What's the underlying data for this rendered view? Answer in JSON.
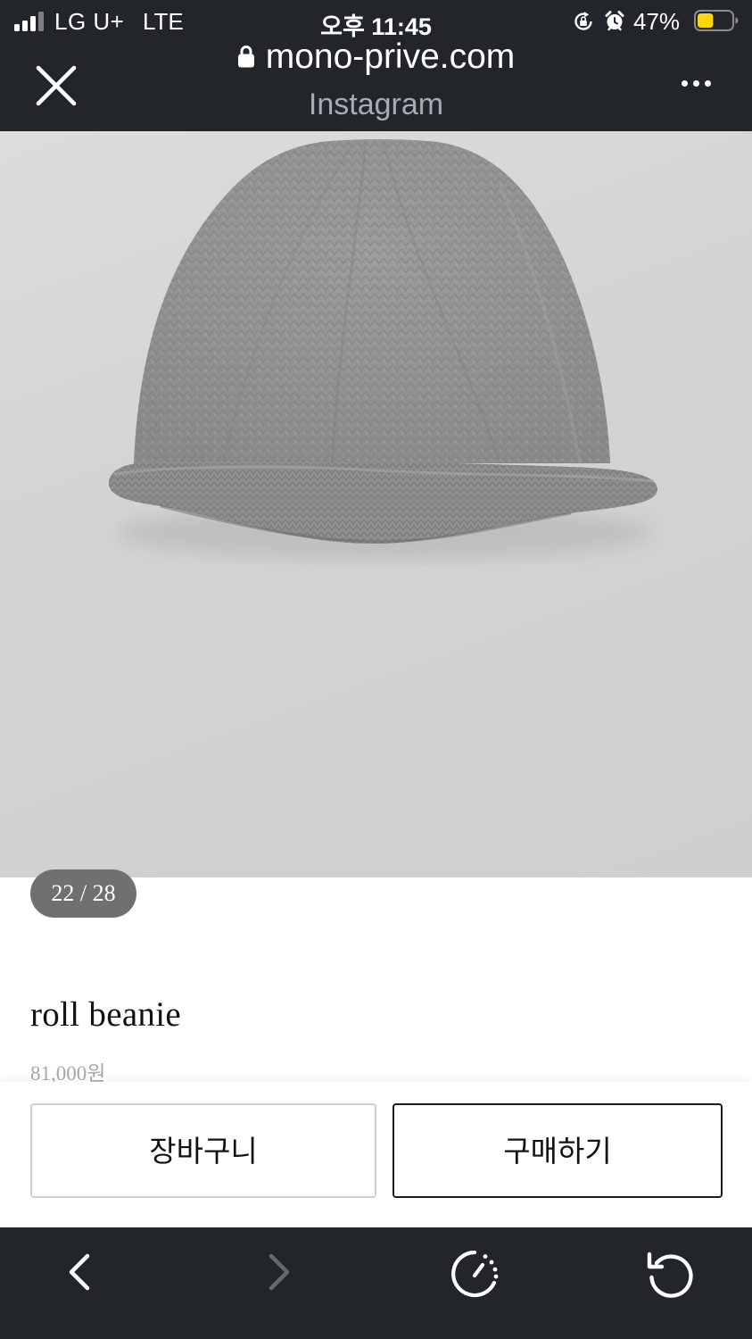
{
  "status_bar": {
    "carrier": "LG U+",
    "network": "LTE",
    "time": "오후 11:45",
    "battery_percent": "47%",
    "battery_level": 0.47,
    "signal_bars": 4,
    "signal_bars_active": 3,
    "icons": [
      "signal-icon",
      "lock-rotation-icon",
      "alarm-icon",
      "battery-icon"
    ]
  },
  "browser": {
    "domain": "mono-prive.com",
    "source": "Instagram",
    "icons": {
      "close": "close-icon",
      "secure": "padlock-icon",
      "menu": "more-icon"
    },
    "theme_color": "#22252a"
  },
  "product": {
    "image_alt": "grey knit roll beanie",
    "counter": "22 / 28",
    "name": "roll beanie",
    "price": "81,000원"
  },
  "actions": {
    "cart_label": "장바구니",
    "buy_label": "구매하기"
  },
  "toolbar": {
    "icons": [
      "back-icon",
      "forward-icon",
      "speed-dial-icon",
      "reload-icon"
    ],
    "forward_disabled": true
  },
  "colors": {
    "chrome": "#22252a",
    "counter_pill": "#707070",
    "price": "#a9a9a9",
    "buy_border": "#1c1c1c",
    "cart_border": "#cfcfcf",
    "battery_fill": "#ffd60a"
  }
}
